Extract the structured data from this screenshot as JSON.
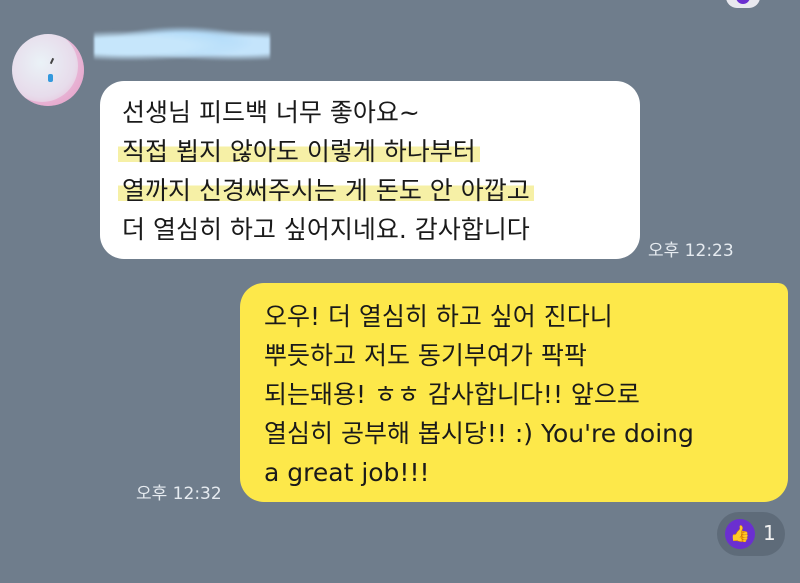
{
  "incoming_message": {
    "lines": [
      {
        "text": "선생님 피드백 너무 좋아요~",
        "highlighted": false
      },
      {
        "text": "직접 뵙지 않아도 이렇게 하나부터",
        "highlighted": true
      },
      {
        "text": "열까지 신경써주시는 게 돈도 안 아깝고",
        "highlighted": true
      },
      {
        "text": "더 열심히 하고 싶어지네요. 감사합니다",
        "highlighted": false
      }
    ],
    "time": "오후 12:23"
  },
  "outgoing_message": {
    "lines": [
      "오우! 더 열심히 하고 싶어 진다니",
      "뿌듯하고 저도 동기부여가 팍팍",
      "되는돼용! ㅎㅎ 감사합니다!! 앞으로",
      "열심히 공부해 봅시당!! :) You're doing",
      "a great job!!!"
    ],
    "time": "오후 12:32"
  },
  "reaction": {
    "icon": "thumbs-up-icon",
    "count": "1",
    "color": "#6b2fd0"
  },
  "colors": {
    "background": "#6f7d8c",
    "incoming_bubble": "#ffffff",
    "outgoing_bubble": "#fde84a",
    "highlight": "#f6f0a6"
  }
}
